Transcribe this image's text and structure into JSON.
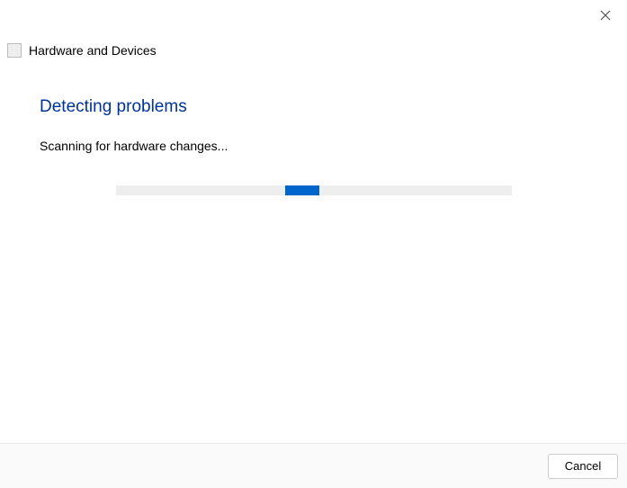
{
  "window": {
    "title": "Hardware and Devices"
  },
  "main": {
    "heading": "Detecting problems",
    "status": "Scanning for hardware changes..."
  },
  "footer": {
    "cancel_label": "Cancel"
  }
}
